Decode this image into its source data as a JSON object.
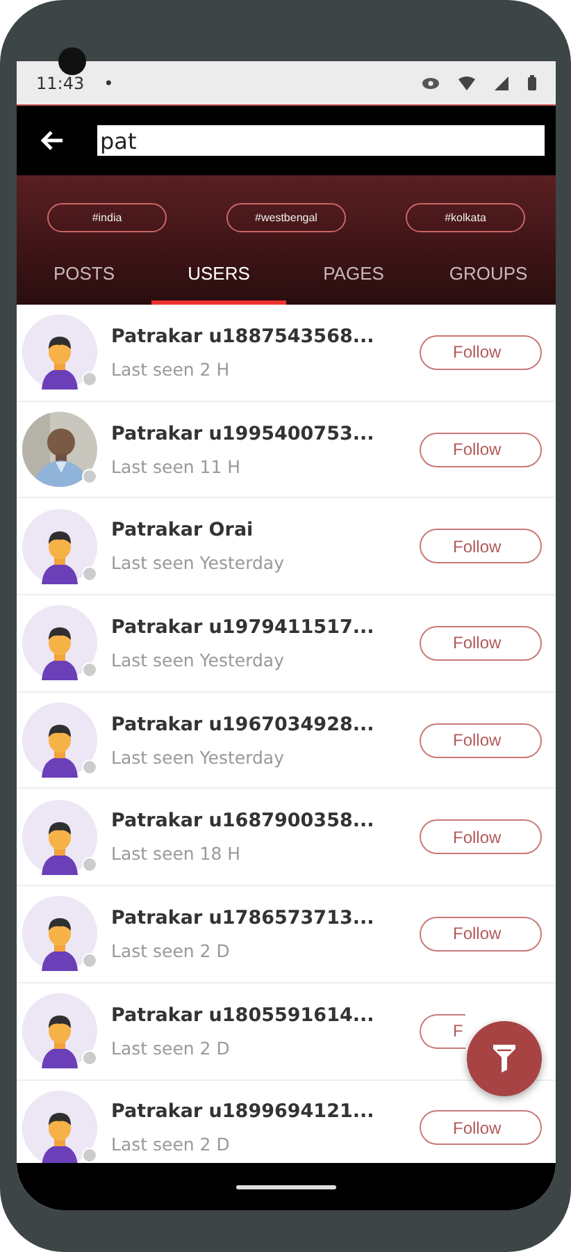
{
  "status_bar": {
    "time": "11:43",
    "dot": "•"
  },
  "search": {
    "value": "pat"
  },
  "hashtags": [
    "#india",
    "#westbengal",
    "#kolkata"
  ],
  "tabs": [
    {
      "label": "POSTS",
      "selected": false
    },
    {
      "label": "USERS",
      "selected": true
    },
    {
      "label": "PAGES",
      "selected": false
    },
    {
      "label": "GROUPS",
      "selected": false
    }
  ],
  "users": [
    {
      "name": "Patrakar u1887543568...",
      "last_seen": "Last seen 2 H",
      "kind": "default",
      "button": "Follow"
    },
    {
      "name": "Patrakar u1995400753...",
      "last_seen": "Last seen 11 H",
      "button": "Follow"
    },
    {
      "name": "Patrakar Orai",
      "last_seen": "Last seen Yesterday",
      "kind": "default",
      "button": "Follow"
    },
    {
      "name": "Patrakar u1979411517...",
      "last_seen": "Last seen Yesterday",
      "kind": "default",
      "button": "Follow"
    },
    {
      "name": "Patrakar u1967034928...",
      "last_seen": "Last seen Yesterday",
      "kind": "default",
      "button": "Follow"
    },
    {
      "name": "Patrakar u1687900358...",
      "last_seen": "Last seen 18 H",
      "kind": "default",
      "button": "Follow"
    },
    {
      "name": "Patrakar u1786573713...",
      "last_seen": "Last seen 2 D",
      "kind": "default",
      "button": "Follow"
    },
    {
      "name": "Patrakar u1805591614...",
      "last_seen": "Last seen 2 D",
      "kind": "default",
      "button": "F",
      "covered": true
    },
    {
      "name": "Patrakar u1899694121...",
      "last_seen": "Last seen 2 D",
      "kind": "default",
      "button": "Follow"
    }
  ]
}
